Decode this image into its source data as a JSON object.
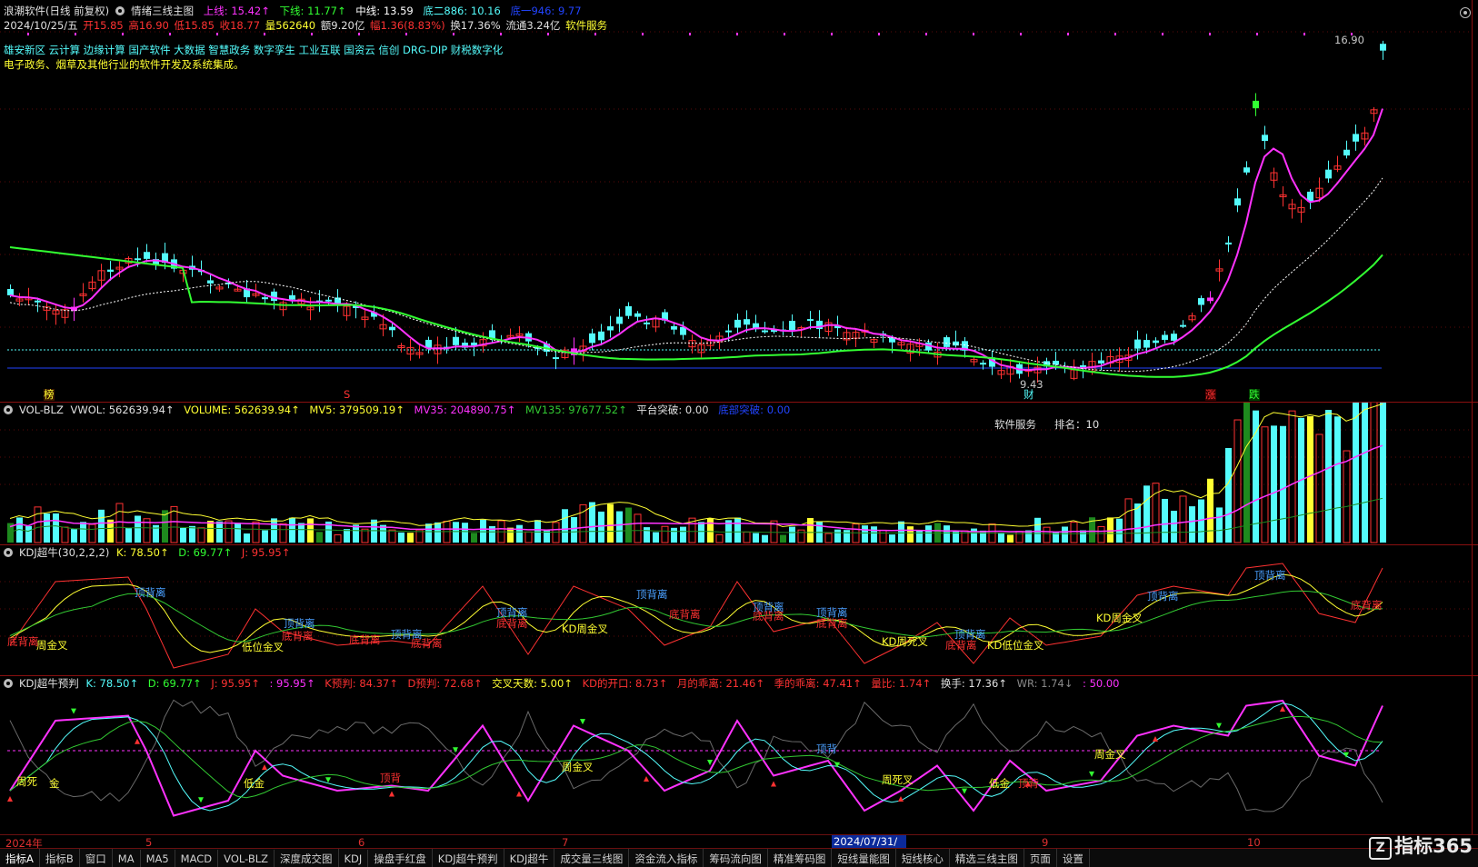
{
  "main": {
    "title": "浪潮软件(日线 前复权)",
    "indicator": "情绪三线主图",
    "upper": "上线: 15.42↑",
    "lower": "下线: 11.77↑",
    "mid": "中线: 13.59",
    "bottom2": "底二886: 10.16",
    "bottom1": "底一946: 9.77",
    "date": "2024/10/25/五",
    "open": "开15.85",
    "high": "高16.90",
    "low": "低15.85",
    "close": "收18.77",
    "volume": "量562640",
    "amount": "额9.20亿",
    "change": "幅1.36(8.83%)",
    "turnover": "换17.36%",
    "float": "流通3.24亿",
    "sector": "软件服务",
    "concepts1": "雄安新区 云计算 边缘计算 国产软件 大数据 智慧政务 数字孪生 工业互联 国资云 信创 DRG-DIP 财税数字化",
    "concepts2": "电子政务、烟草及其他行业的软件开发及系统集成。",
    "price_high_label": "16.90",
    "price_low_label": "9.43",
    "marks": {
      "bang": "榜",
      "s": "S",
      "cai": "财",
      "zhang": "涨",
      "die": "跌"
    }
  },
  "vol": {
    "name": "VOL-BLZ",
    "wvol": "VWOL: 562639.94↑",
    "volume": "VOLUME: 562639.94↑",
    "mv5": "MV5: 379509.19↑",
    "mv35": "MV35: 204890.75↑",
    "mv135": "MV135: 97677.52↑",
    "platform": "平台突破: 0.00",
    "bottom": "底部突破: 0.00",
    "rank_sector": "软件服务",
    "rank": "排名：10"
  },
  "kdj1": {
    "name": "KDJ超牛(30,2,2,2)",
    "k": "K: 78.50↑",
    "d": "D: 69.77↑",
    "j": "J: 95.95↑",
    "labels": {
      "top": "顶背离",
      "bottom": "底背离",
      "low_gold": "低位金叉",
      "kd_week_gold": "KD周金叉",
      "week_gold": "周金叉",
      "kd_week_death": "KD周死叉",
      "kd_low_gold": "KD低位金叉"
    }
  },
  "kdj2": {
    "name": "KDJ超牛预判",
    "k": "K: 78.50↑",
    "d": "D: 69.77↑",
    "j": "J: 95.95↑",
    "jj": ": 95.95↑",
    "kpre": "K预判: 84.37↑",
    "dpre": "D预判: 72.68↑",
    "cross_days": "交叉天数: 5.00↑",
    "kd_open": "KD的开口: 8.73↑",
    "month_dev": "月的乖离: 21.46↑",
    "season_dev": "季的乖离: 47.41↑",
    "vol_ratio": "量比: 1.74↑",
    "turnover": "换手: 17.36↑",
    "wr": "WR: 1.74↓",
    "last": ": 50.00",
    "labels": {
      "week_death": "周死",
      "gold": "金",
      "low_gold": "低金",
      "top_div": "顶背",
      "week_gold": "周金叉",
      "week_death_cross": "周死叉"
    }
  },
  "timeaxis": {
    "y2024": "2024年",
    "m5": "5",
    "m6": "6",
    "m7": "7",
    "selected": "2024/07/31/三",
    "m9": "9",
    "m10": "10"
  },
  "tabs": [
    "指标A",
    "指标B",
    "窗口",
    "MA",
    "MA5",
    "MACD",
    "VOL-BLZ",
    "深度成交图",
    "KDJ",
    "操盘手红盘",
    "KDJ超牛预判",
    "KDJ超牛",
    "成交量三线图",
    "资金流入指标",
    "筹码流向图",
    "精准筹码图",
    "短线量能图",
    "短线核心",
    "精选三线主图",
    "页面",
    "设置"
  ],
  "logo": "指标365",
  "colors": {
    "bg": "#000000",
    "up": "#ff3232",
    "down": "#54fcfc",
    "ma_pink": "#ff32ff",
    "ma_green": "#32ff32",
    "ma_white": "#ffffff",
    "yellow": "#ffff32",
    "divider": "#8a1010"
  }
}
